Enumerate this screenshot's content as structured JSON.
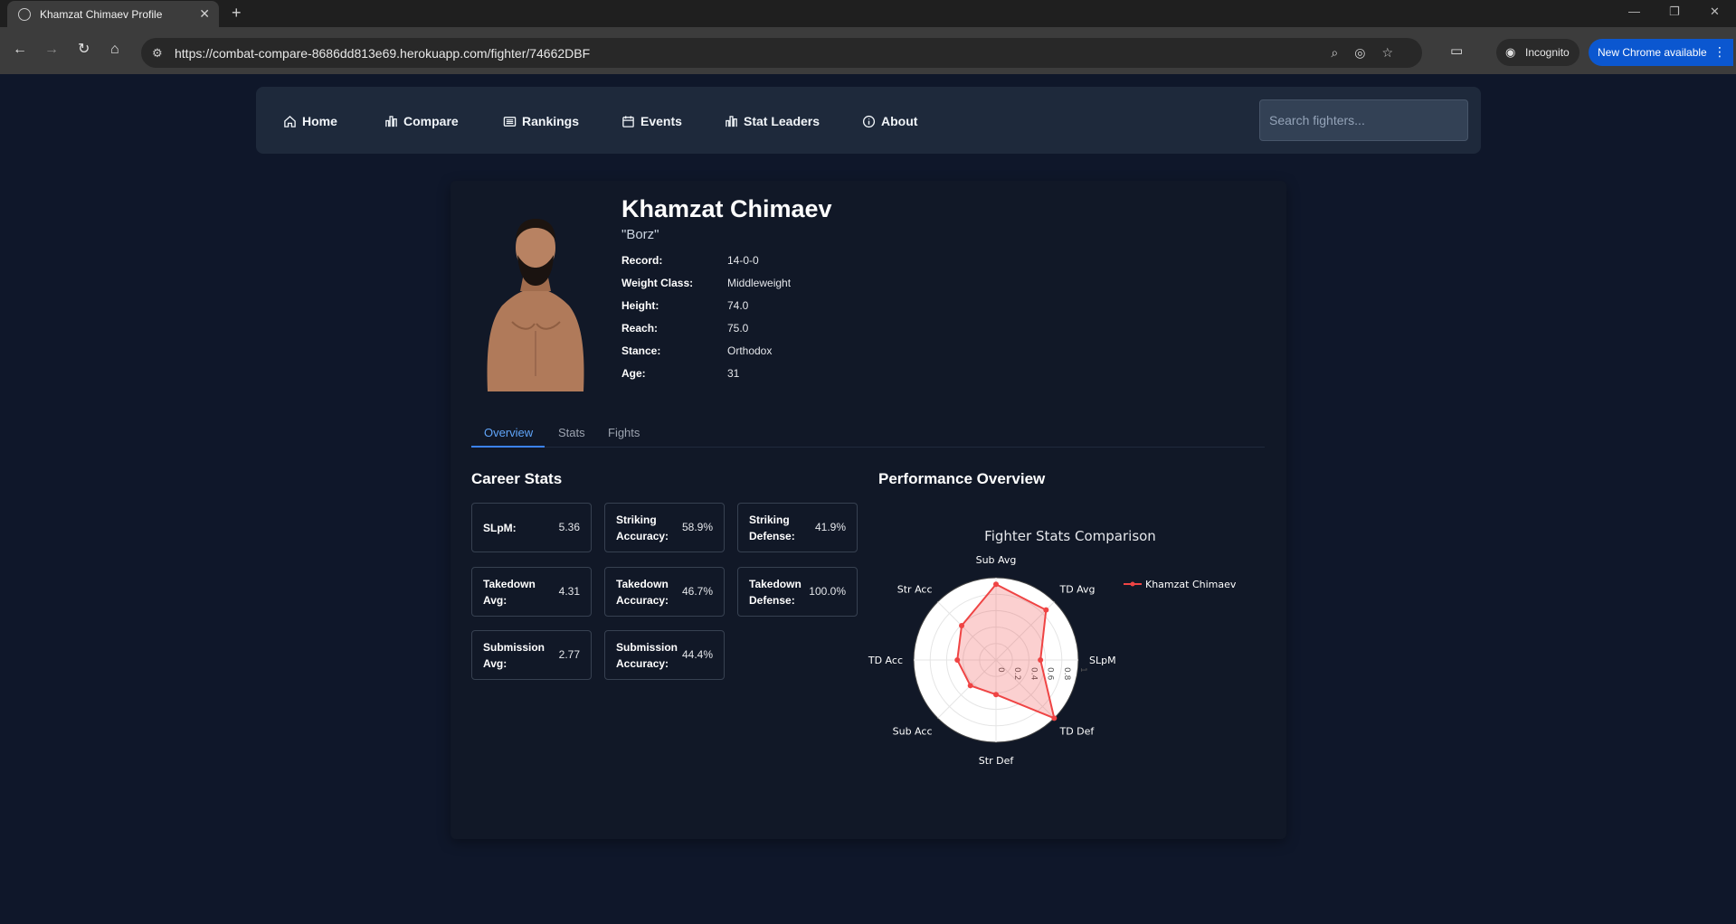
{
  "browser": {
    "tab_title": "Khamzat Chimaev Profile",
    "url": "https://combat-compare-8686dd813e69.herokuapp.com/fighter/74662DBF",
    "incognito_label": "Incognito",
    "update_label": "New Chrome available"
  },
  "nav": {
    "items": [
      {
        "label": "Home",
        "icon": "home-icon"
      },
      {
        "label": "Compare",
        "icon": "bar-chart-icon"
      },
      {
        "label": "Rankings",
        "icon": "list-icon"
      },
      {
        "label": "Events",
        "icon": "calendar-icon"
      },
      {
        "label": "Stat Leaders",
        "icon": "bar-chart-icon"
      },
      {
        "label": "About",
        "icon": "info-icon"
      }
    ],
    "search_placeholder": "Search fighters..."
  },
  "fighter": {
    "name": "Khamzat Chimaev",
    "nickname": "\"Borz\"",
    "info": [
      {
        "label": "Record:",
        "value": "14-0-0"
      },
      {
        "label": "Weight Class:",
        "value": "Middleweight"
      },
      {
        "label": "Height:",
        "value": "74.0"
      },
      {
        "label": "Reach:",
        "value": "75.0"
      },
      {
        "label": "Stance:",
        "value": "Orthodox"
      },
      {
        "label": "Age:",
        "value": "31"
      }
    ]
  },
  "profile_tabs": [
    "Overview",
    "Stats",
    "Fights"
  ],
  "career_stats": {
    "title": "Career Stats",
    "items": [
      {
        "label": "SLpM:",
        "value": "5.36"
      },
      {
        "label": "Striking Accuracy:",
        "value": "58.9%"
      },
      {
        "label": "Striking Defense:",
        "value": "41.9%"
      },
      {
        "label": "Takedown Avg:",
        "value": "4.31"
      },
      {
        "label": "Takedown Accuracy:",
        "value": "46.7%"
      },
      {
        "label": "Takedown Defense:",
        "value": "100.0%"
      },
      {
        "label": "Submission Avg:",
        "value": "2.77"
      },
      {
        "label": "Submission Accuracy:",
        "value": "44.4%"
      }
    ]
  },
  "performance": {
    "title": "Performance Overview"
  },
  "chart_data": {
    "type": "radar",
    "title": "Fighter Stats Comparison",
    "categories": [
      "SLpM",
      "TD Avg",
      "Sub Avg",
      "Str Acc",
      "TD Acc",
      "Sub Acc",
      "Str Def",
      "TD Def"
    ],
    "radial_ticks": [
      "0",
      "0.2",
      "0.4",
      "0.6",
      "0.8",
      "1"
    ],
    "rlim": [
      0,
      1
    ],
    "series": [
      {
        "name": "Khamzat Chimaev",
        "values": [
          0.54,
          0.86,
          0.92,
          0.59,
          0.47,
          0.44,
          0.42,
          1.0
        ],
        "color": "#ef4444"
      }
    ],
    "legend_position": "top-right"
  }
}
